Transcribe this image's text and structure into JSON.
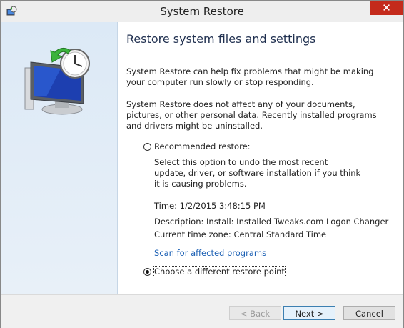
{
  "window": {
    "title": "System Restore",
    "close_glyph": "✕",
    "icon": "system-restore-icon"
  },
  "content": {
    "heading": "Restore system files and settings",
    "para1": "System Restore can help fix problems that might be making your computer run slowly or stop responding.",
    "para2": "System Restore does not affect any of your documents, pictures, or other personal data. Recently installed programs and drivers might be uninstalled.",
    "recommended": {
      "label": "Recommended restore:",
      "checked": false,
      "description": "Select this option to undo the most recent update, driver, or software installation if you think it is causing problems.",
      "time": "Time: 1/2/2015 3:48:15 PM",
      "description_line": "Description: Install: Installed Tweaks.com Logon Changer",
      "timezone": "Current time zone: Central Standard Time",
      "scan_link": "Scan for affected programs"
    },
    "different": {
      "label": "Choose a different restore point",
      "checked": true
    }
  },
  "footer": {
    "back": "< Back",
    "next": "Next >",
    "cancel": "Cancel"
  },
  "colors": {
    "link": "#1a5fb4",
    "close_bg": "#c42b1c",
    "sidebar_bg": "#dce9f6"
  }
}
